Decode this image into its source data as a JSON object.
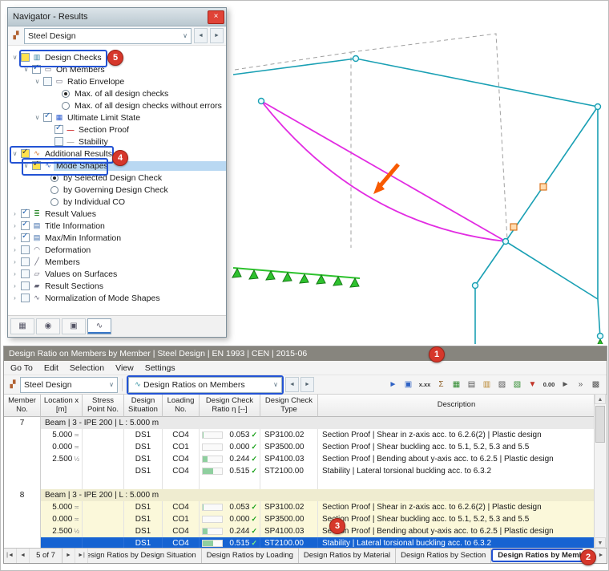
{
  "annotations": {
    "callouts": [
      "1",
      "2",
      "3",
      "4",
      "5"
    ]
  },
  "icons": {
    "close": "×",
    "steel": "▞",
    "combo-arrow": "∨",
    "spin-left": "◄",
    "spin-right": "►",
    "expand-open": "∨",
    "expand-closed": "›",
    "design-checks": "▥",
    "on-members": "▭",
    "ratio-envelope": "▭",
    "ultimate-limit-state": "▦",
    "section-proof": "—",
    "stability": "—",
    "additional-results": "∿",
    "mode-shapes": "∿",
    "result-values": "≣",
    "title-information": "▤",
    "maxmin-information": "▤",
    "deformation": "◠",
    "members": "╱",
    "values-on-surfaces": "▱",
    "result-sections": "▰",
    "normalization": "∿",
    "panel-display": "▦",
    "panel-visibility": "◉",
    "panel-camera": "▣",
    "panel-results": "∿",
    "result-type": "∿",
    "t-select": "►",
    "t-box": "▣",
    "t-values": "x.xx",
    "t-sum": "Σ",
    "t-grid": "▦",
    "t-table": "▤",
    "t-folder": "▥",
    "t-print": "▨",
    "t-export": "▧",
    "t-funnel": "▼",
    "t-zeros": "0.00",
    "t-pointer": "►",
    "t-overflow": "»",
    "t-panel": "▩",
    "rec-first": "|◄",
    "rec-prev": "◄",
    "rec-next": "►",
    "rec-last": "►|",
    "tab-left": "◄",
    "tab-right": "►",
    "scroll-up": "▲",
    "scroll-down": "▼",
    "check": "✓"
  },
  "navigator": {
    "title": "Navigator - Results",
    "combo_value": "Steel Design",
    "tree": [
      {
        "label": "Design Checks",
        "level": 0,
        "expander": "open",
        "check": "yellow",
        "icon": "design-checks"
      },
      {
        "label": "On Members",
        "level": 1,
        "expander": "open",
        "check": "checked",
        "icon": "on-members"
      },
      {
        "label": "Ratio Envelope",
        "level": 2,
        "expander": "open",
        "check": "unchecked",
        "icon": "ratio-envelope"
      },
      {
        "label": "Max. of all design checks",
        "level": 3,
        "radio": "on"
      },
      {
        "label": "Max. of all design checks without errors",
        "level": 3,
        "radio": "off"
      },
      {
        "label": "Ultimate Limit State",
        "level": 2,
        "expander": "open",
        "check": "checked",
        "icon": "ultimate-limit-state"
      },
      {
        "label": "Section Proof",
        "level": 3,
        "check": "checked",
        "icon": "section-proof"
      },
      {
        "label": "Stability",
        "level": 3,
        "check": "unchecked",
        "icon": "stability"
      },
      {
        "label": "Additional Results",
        "level": 0,
        "expander": "open",
        "check": "yellow-checked",
        "icon": "additional-results"
      },
      {
        "label": "Mode Shapes",
        "level": 1,
        "expander": "open",
        "check": "yellow-checked",
        "icon": "mode-shapes",
        "selected": true
      },
      {
        "label": "by Selected Design Check",
        "level": 2,
        "radio": "on"
      },
      {
        "label": "by Governing Design Check",
        "level": 2,
        "radio": "off"
      },
      {
        "label": "by Individual CO",
        "level": 2,
        "radio": "off"
      },
      {
        "label": "Result Values",
        "level": 0,
        "expander": "closed",
        "check": "checked",
        "icon": "result-values"
      },
      {
        "label": "Title Information",
        "level": 0,
        "expander": "closed",
        "check": "checked",
        "icon": "title-information"
      },
      {
        "label": "Max/Min Information",
        "level": 0,
        "expander": "closed",
        "check": "checked",
        "icon": "maxmin-information"
      },
      {
        "label": "Deformation",
        "level": 0,
        "expander": "closed",
        "check": "unchecked",
        "icon": "deformation"
      },
      {
        "label": "Members",
        "level": 0,
        "expander": "closed",
        "check": "unchecked",
        "icon": "members"
      },
      {
        "label": "Values on Surfaces",
        "level": 0,
        "expander": "closed",
        "check": "unchecked",
        "icon": "values-on-surfaces"
      },
      {
        "label": "Result Sections",
        "level": 0,
        "expander": "closed",
        "check": "unchecked",
        "icon": "result-sections"
      },
      {
        "label": "Normalization of Mode Shapes",
        "level": 0,
        "expander": "closed",
        "check": "unchecked",
        "icon": "normalization"
      }
    ],
    "panel_tabs": [
      {
        "name": "display-properties-tab",
        "icon": "panel-display"
      },
      {
        "name": "visibility-tab",
        "icon": "panel-visibility"
      },
      {
        "name": "camera-tab",
        "icon": "panel-camera"
      },
      {
        "name": "results-tab",
        "icon": "panel-results",
        "active": true
      }
    ]
  },
  "viewport": {
    "colors": {
      "frame": "#1aa0b4",
      "dashed": "#a0a0a0",
      "mode_shape": "#e22ce2",
      "supports": "#2ec22e",
      "supports_dark": "#157a15",
      "hinge": "#d9751e",
      "hinge_fill": "#ffdcb0",
      "arrow": "#f85a00",
      "node_fill": "#eafdff"
    }
  },
  "table_panel": {
    "title": "Design Ratio on Members by Member | Steel Design | EN 1993 | CEN | 2015-06",
    "menu": [
      "Go To",
      "Edit",
      "Selection",
      "View",
      "Settings"
    ],
    "toolbar": {
      "combo1": "Steel Design",
      "combo2": "Design Ratios on Members",
      "icons": [
        {
          "name": "select-members-icon",
          "icon": "t-select"
        },
        {
          "name": "box-select-icon",
          "icon": "t-box"
        },
        {
          "name": "show-values-icon",
          "icon": "t-values",
          "text": true
        },
        {
          "name": "extreme-values-icon",
          "icon": "t-sum"
        },
        {
          "name": "result-grid-icon",
          "icon": "t-grid"
        },
        {
          "name": "table-views-icon",
          "icon": "t-table"
        },
        {
          "name": "table-folders-icon",
          "icon": "t-folder"
        },
        {
          "name": "print-icon",
          "icon": "t-print"
        },
        {
          "name": "export-icon",
          "icon": "t-export"
        },
        {
          "name": "filter-funnel-icon",
          "icon": "t-funnel"
        },
        {
          "name": "decimal-filter-icon",
          "icon": "t-zeros",
          "text": true
        },
        {
          "name": "jump-to-graphic-icon",
          "icon": "t-pointer"
        },
        {
          "name": "overflow-icon",
          "icon": "t-overflow"
        },
        {
          "name": "panel-toggle-icon",
          "icon": "t-panel"
        }
      ]
    },
    "columns": [
      "Member No.",
      "Location x [m]",
      "Stress Point No.",
      "Design Situation",
      "Loading No.",
      "Design Check Ratio η [--]",
      "Design Check Type",
      "Description"
    ],
    "groups": [
      {
        "member": "7",
        "header": "Beam | 3 - IPE 200 | L : 5.000 m",
        "highlight": false,
        "rows": [
          {
            "loc": "5.000",
            "loc_sym": "≍",
            "sp": "",
            "ds": "DS1",
            "load": "CO4",
            "ratio": 0.053,
            "ratio_str": "0.053",
            "type": "SP3100.02",
            "desc": "Section Proof | Shear in z-axis acc. to 6.2.6(2) | Plastic design"
          },
          {
            "loc": "0.000",
            "loc_sym": "≍",
            "sp": "",
            "ds": "DS1",
            "load": "CO1",
            "ratio": 0.0,
            "ratio_str": "0.000",
            "type": "SP3500.00",
            "desc": "Section Proof | Shear buckling acc. to 5.1, 5.2, 5.3 and 5.5"
          },
          {
            "loc": "2.500",
            "loc_sym": "½",
            "sp": "",
            "ds": "DS1",
            "load": "CO4",
            "ratio": 0.244,
            "ratio_str": "0.244",
            "type": "SP4100.03",
            "desc": "Section Proof | Bending about y-axis acc. to 6.2.5 | Plastic design"
          },
          {
            "loc": "",
            "loc_sym": "",
            "sp": "",
            "ds": "DS1",
            "load": "CO4",
            "ratio": 0.515,
            "ratio_str": "0.515",
            "type": "ST2100.00",
            "desc": "Stability | Lateral torsional buckling acc. to 6.3.2"
          }
        ]
      },
      {
        "member": "8",
        "header": "Beam | 3 - IPE 200 | L : 5.000 m",
        "highlight": true,
        "rows": [
          {
            "loc": "5.000",
            "loc_sym": "≍",
            "sp": "",
            "ds": "DS1",
            "load": "CO4",
            "ratio": 0.053,
            "ratio_str": "0.053",
            "type": "SP3100.02",
            "desc": "Section Proof | Shear in z-axis acc. to 6.2.6(2) | Plastic design"
          },
          {
            "loc": "0.000",
            "loc_sym": "≍",
            "sp": "",
            "ds": "DS1",
            "load": "CO1",
            "ratio": 0.0,
            "ratio_str": "0.000",
            "type": "SP3500.00",
            "desc": "Section Proof | Shear buckling acc. to 5.1, 5.2, 5.3 and 5.5"
          },
          {
            "loc": "2.500",
            "loc_sym": "½",
            "sp": "",
            "ds": "DS1",
            "load": "CO4",
            "ratio": 0.244,
            "ratio_str": "0.244",
            "type": "SP4100.03",
            "desc": "Section Proof | Bending about y-axis acc. to 6.2.5 | Plastic design"
          },
          {
            "loc": "",
            "loc_sym": "",
            "sp": "",
            "ds": "DS1",
            "load": "CO4",
            "ratio": 0.515,
            "ratio_str": "0.515",
            "type": "ST2100.00",
            "desc": "Stability | Lateral torsional buckling acc. to 6.3.2",
            "selected": true
          }
        ]
      }
    ],
    "nav": {
      "position": "5 of 7"
    },
    "tabs": [
      {
        "label": "Design Ratios by Design Situation",
        "clipped": true
      },
      {
        "label": "Design Ratios by Loading"
      },
      {
        "label": "Design Ratios by Material"
      },
      {
        "label": "Design Ratios by Section"
      },
      {
        "label": "Design Ratios by Member",
        "active": true
      }
    ]
  }
}
